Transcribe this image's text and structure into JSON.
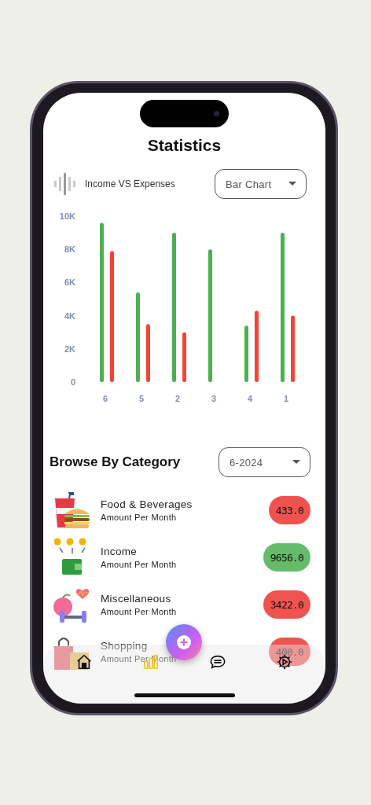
{
  "screen": {
    "title": "Statistics"
  },
  "chart_header": {
    "legend_label": "Income VS Expenses",
    "chart_type": "Bar Chart"
  },
  "chart": {
    "chart_data": {
      "type": "bar",
      "categories": [
        "6",
        "5",
        "2",
        "3",
        "4",
        "1"
      ],
      "ylim": [
        0,
        10000
      ],
      "yticks": [
        {
          "value": 0,
          "label": "0"
        },
        {
          "value": 2000,
          "label": "2K"
        },
        {
          "value": 4000,
          "label": "4K"
        },
        {
          "value": 6000,
          "label": "6K"
        },
        {
          "value": 8000,
          "label": "8K"
        },
        {
          "value": 10000,
          "label": "10K"
        }
      ],
      "series": [
        {
          "color": "#4caf50",
          "values": [
            9600,
            5400,
            9000,
            8000,
            3400,
            9000
          ]
        },
        {
          "color": "#f44336",
          "values": [
            7900,
            3500,
            3000,
            null,
            4300,
            4000
          ]
        }
      ]
    }
  },
  "category_section": {
    "title": "Browse By Category",
    "month": "6-2024"
  },
  "categories": [
    {
      "kind": "food",
      "name": "Food & Beverages",
      "subtitle": "Amount Per Month",
      "amount": "433.0",
      "color": "#ef5350"
    },
    {
      "kind": "income",
      "name": "Income",
      "subtitle": "Amount Per Month",
      "amount": "9656.0",
      "color": "#66bb6a"
    },
    {
      "kind": "health",
      "name": "Miscellaneous",
      "subtitle": "Amount Per Month",
      "amount": "3422.0",
      "color": "#ef5350"
    },
    {
      "kind": "shopping",
      "name": "Shopping",
      "subtitle": "Amount Per Month",
      "amount": "400.0",
      "color": "#ef5350"
    }
  ],
  "nav": {
    "items": [
      {
        "kind": "home",
        "selected": false
      },
      {
        "kind": "stats",
        "selected": true
      },
      {
        "kind": "chat",
        "selected": false
      },
      {
        "kind": "settings",
        "selected": false
      }
    ]
  }
}
